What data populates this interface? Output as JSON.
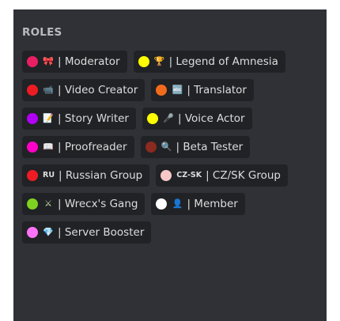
{
  "section": {
    "title": "ROLES"
  },
  "roles": [
    {
      "label": "| Moderator",
      "color": "#e91e63",
      "emoji": "🎀",
      "emoji_name": "ribbon-icon",
      "emoji_color": "#f06292"
    },
    {
      "label": "| Legend of Amnesia",
      "color": "#ffff00",
      "emoji": "🏆",
      "emoji_name": "trophy-icon",
      "emoji_color": "#f4b400"
    },
    {
      "label": "| Video Creator",
      "color": "#ed1c24",
      "emoji": "📹",
      "emoji_name": "video-camera-icon",
      "emoji_color": "#9aa0a6"
    },
    {
      "label": "| Translator",
      "color": "#f26b1d",
      "emoji": "🔤",
      "emoji_name": "abcd-input-icon",
      "emoji_color": "#3b88c3"
    },
    {
      "label": "| Story Writer",
      "color": "#b100f5",
      "emoji": "📝",
      "emoji_name": "memo-icon",
      "emoji_color": "#f5d76e"
    },
    {
      "label": "| Voice Actor",
      "color": "#ffff00",
      "emoji": "🎤",
      "emoji_name": "microphone-icon",
      "emoji_color": "#cfd8dc"
    },
    {
      "label": "| Proofreader",
      "color": "#ff00c8",
      "emoji": "📖",
      "emoji_name": "open-book-icon",
      "emoji_color": "#e0e0e0"
    },
    {
      "label": "| Beta Tester",
      "color": "#8b2a1f",
      "emoji": "🔍",
      "emoji_name": "magnifying-glass-icon",
      "emoji_color": "#cfd8dc"
    },
    {
      "label": "| Russian Group",
      "color": "#ed1c24",
      "emoji": "RU",
      "emoji_name": "ru-tag-icon",
      "emoji_color": "#dcddde",
      "emoji_is_text": true
    },
    {
      "label": "| CZ/SK Group",
      "color": "#f7c8c8",
      "emoji": "CZ-SK",
      "emoji_name": "cz-sk-tag-icon",
      "emoji_color": "#dcddde",
      "emoji_is_text": true
    },
    {
      "label": "| Wrecx's Gang",
      "color": "#7ed321",
      "emoji": "⚔",
      "emoji_name": "crossed-swords-icon",
      "emoji_color": "#c5e1a5"
    },
    {
      "label": "| Member",
      "color": "#ffffff",
      "emoji": "👤",
      "emoji_name": "bust-silhouette-icon",
      "emoji_color": "#9aa0a6"
    },
    {
      "label": "| Server Booster",
      "color": "#ff73fa",
      "emoji": "💎",
      "emoji_name": "gem-icon",
      "emoji_color": "#4fc3f7"
    }
  ]
}
